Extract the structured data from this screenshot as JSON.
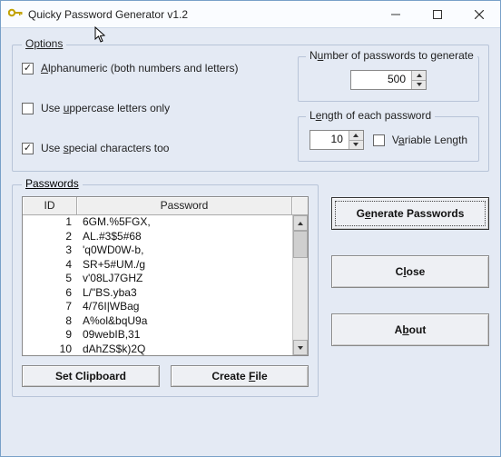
{
  "window": {
    "title": "Quicky Password Generator  v1.2"
  },
  "options": {
    "legend": "Options",
    "alphanumeric": {
      "checked": true,
      "label_pre": "A",
      "label_post": "lphanumeric (both numbers and letters)"
    },
    "uppercase": {
      "checked": false,
      "label_pre": "Use ",
      "label_u": "u",
      "label_post": "ppercase letters only"
    },
    "special": {
      "checked": true,
      "label_pre": "Use ",
      "label_u": "s",
      "label_post": "pecial characters too"
    },
    "num_group": {
      "legend_pre": "N",
      "legend_u": "u",
      "legend_post": "mber of passwords to generate",
      "value": "500"
    },
    "len_group": {
      "legend_pre": "L",
      "legend_u": "e",
      "legend_post": "ngth of each password",
      "value": "10",
      "variable": {
        "checked": false,
        "label_pre": "V",
        "label_u": "a",
        "label_post": "riable Length"
      }
    }
  },
  "passwords": {
    "legend": "Passwords",
    "header_id": "ID",
    "header_pw": "Password",
    "rows": [
      {
        "id": "1",
        "pw": "6GM.%5FGX,"
      },
      {
        "id": "2",
        "pw": "AL.#3$5#68"
      },
      {
        "id": "3",
        "pw": "'q0WD0W-b,"
      },
      {
        "id": "4",
        "pw": "SR+5#UM./g"
      },
      {
        "id": "5",
        "pw": "v'08LJ7GHZ"
      },
      {
        "id": "6",
        "pw": "L/\"BS.yba3"
      },
      {
        "id": "7",
        "pw": "4/76I|WBag"
      },
      {
        "id": "8",
        "pw": "A%ol&bqU9a"
      },
      {
        "id": "9",
        "pw": "09webIB,31"
      },
      {
        "id": "10",
        "pw": "dAhZS$k)2Q"
      }
    ],
    "set_clipboard": "Set Clipboard",
    "create_file_pre": "Create ",
    "create_file_u": "F",
    "create_file_post": "ile"
  },
  "buttons": {
    "generate_pre": "G",
    "generate_u": "e",
    "generate_post": "nerate Passwords",
    "close_pre": "C",
    "close_u": "l",
    "close_post": "ose",
    "about_pre": "A",
    "about_u": "b",
    "about_post": "out"
  }
}
